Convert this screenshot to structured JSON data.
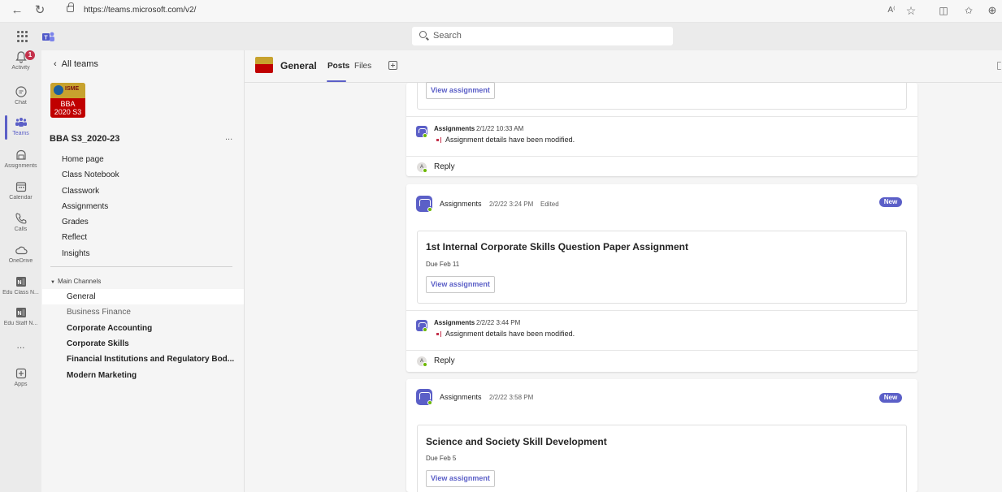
{
  "browser": {
    "url": "https://teams.microsoft.com/v2/"
  },
  "header": {
    "search_placeholder": "Search"
  },
  "rail": {
    "activity_badge": "1",
    "items": [
      {
        "label": "Activity"
      },
      {
        "label": "Chat"
      },
      {
        "label": "Teams"
      },
      {
        "label": "Assignments"
      },
      {
        "label": "Calendar"
      },
      {
        "label": "Calls"
      },
      {
        "label": "OneDrive"
      },
      {
        "label": "Edu Class N..."
      },
      {
        "label": "Edu Staff N..."
      },
      {
        "label": "..."
      },
      {
        "label": "Apps"
      }
    ]
  },
  "team": {
    "back_label": "All teams",
    "avatar_line1": "BBA",
    "avatar_line2": "2020 S3",
    "avatar_logo": "ISME",
    "name": "BBA S3_2020-23",
    "more": "...",
    "links": [
      "Home page",
      "Class Notebook",
      "Classwork",
      "Assignments",
      "Grades",
      "Reflect",
      "Insights"
    ],
    "channels_heading": "Main Channels",
    "channels": [
      "General",
      "Business Finance",
      "Corporate Accounting",
      "Corporate Skills",
      "Financial Institutions and Regulatory Bod...",
      "Modern Marketing"
    ]
  },
  "channel": {
    "title": "General",
    "tabs": [
      "Posts",
      "Files"
    ]
  },
  "feed": {
    "view_label": "View assignment",
    "reply_label": "Reply",
    "reply_initial": "A",
    "new_label": "New",
    "modified_text": "Assignment details have been modified.",
    "sender": "Assignments",
    "msg1_ts": "2/1/22 10:33 AM",
    "post2_ts": "2/2/22 3:24 PM",
    "edited": "Edited",
    "post2_title": "1st Internal Corporate Skills Question Paper Assignment",
    "post2_due": "Due Feb 11",
    "msg2_ts": "2/2/22 3:44 PM",
    "post3_ts": "2/2/22 3:58 PM",
    "post3_title": "Science and Society Skill Development",
    "post3_due": "Due Feb 5"
  }
}
